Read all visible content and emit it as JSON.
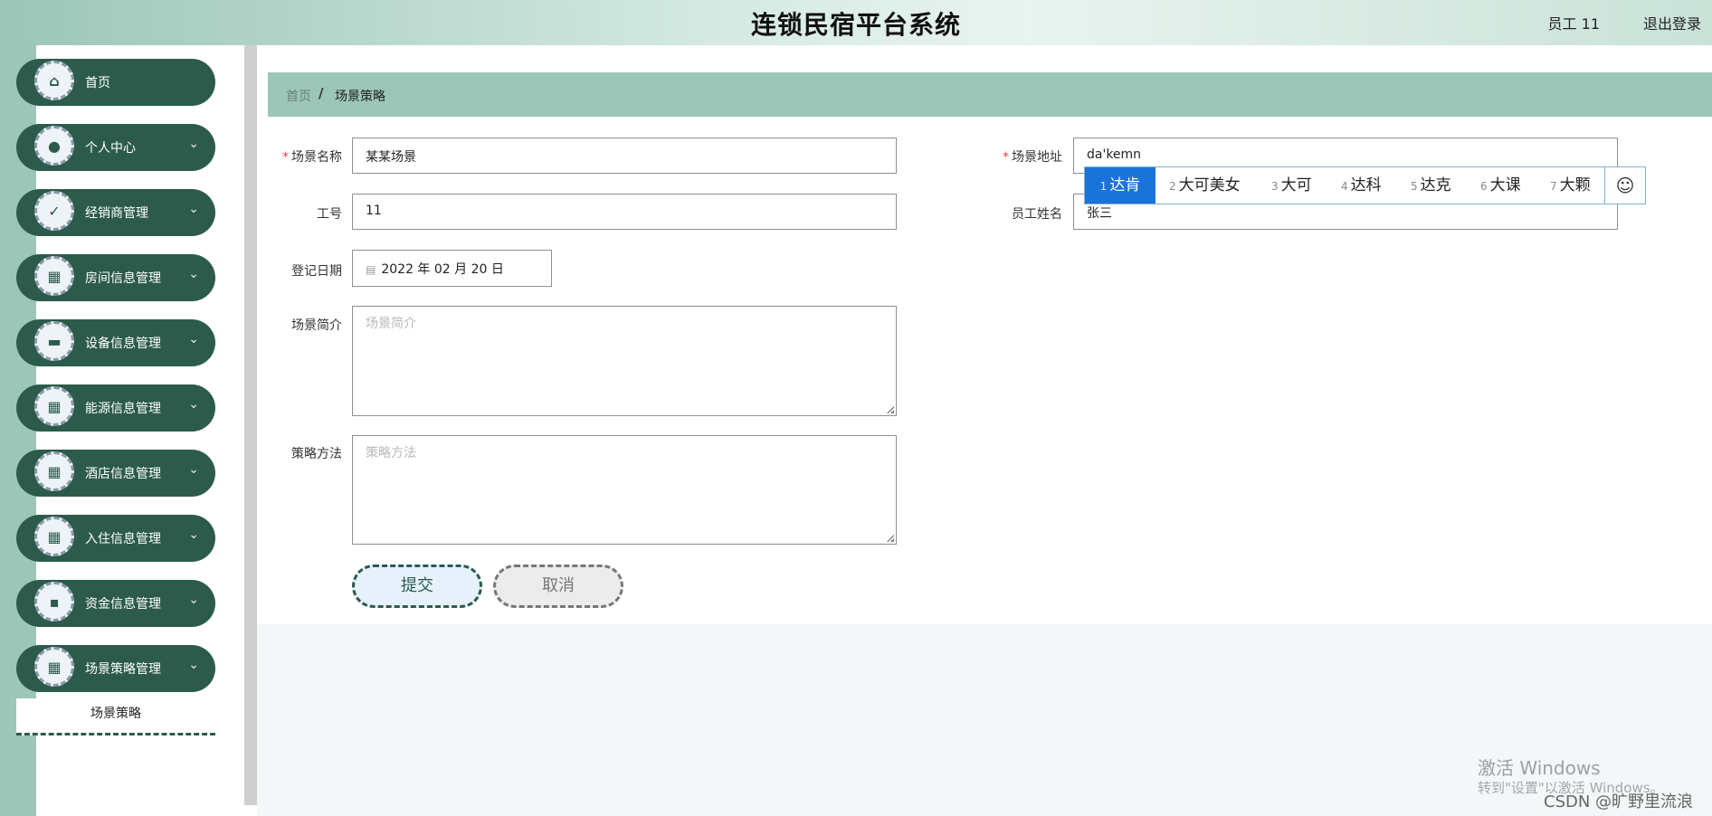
{
  "header": {
    "title": "连锁民宿平台系统",
    "user": "员工 11",
    "logout": "退出登录"
  },
  "sidebar": {
    "items": [
      {
        "label": "首页",
        "icon": "home-icon",
        "glyph": "⌂",
        "has_children": false
      },
      {
        "label": "个人中心",
        "icon": "user-icon",
        "glyph": "●",
        "has_children": true
      },
      {
        "label": "经销商管理",
        "icon": "clipboard-icon",
        "glyph": "✓",
        "has_children": true
      },
      {
        "label": "房间信息管理",
        "icon": "grid-icon",
        "glyph": "▦",
        "has_children": true
      },
      {
        "label": "设备信息管理",
        "icon": "device-icon",
        "glyph": "▬",
        "has_children": true
      },
      {
        "label": "能源信息管理",
        "icon": "grid-icon",
        "glyph": "▦",
        "has_children": true
      },
      {
        "label": "酒店信息管理",
        "icon": "grid-icon",
        "glyph": "▦",
        "has_children": true
      },
      {
        "label": "入住信息管理",
        "icon": "grid-icon",
        "glyph": "▦",
        "has_children": true
      },
      {
        "label": "资金信息管理",
        "icon": "chat-icon",
        "glyph": "▪",
        "has_children": true
      },
      {
        "label": "场景策略管理",
        "icon": "grid-icon",
        "glyph": "▦",
        "has_children": true
      }
    ],
    "submenu": {
      "label": "场景策略"
    },
    "chevron": "⌄"
  },
  "breadcrumb": {
    "home": "首页",
    "separator": "/",
    "current": "场景策略"
  },
  "form": {
    "scene_name": {
      "label": "场景名称",
      "value": "某某场景",
      "required": true
    },
    "scene_address": {
      "label": "场景地址",
      "value": "da'kemn",
      "required": true
    },
    "employee_no": {
      "label": "工号",
      "value": "11"
    },
    "employee_name": {
      "label": "员工姓名",
      "value": "张三"
    },
    "register_date": {
      "label": "登记日期",
      "value": "2022 年 02 月 20 日"
    },
    "scene_intro": {
      "label": "场景简介",
      "placeholder": "场景简介"
    },
    "strategy_method": {
      "label": "策略方法",
      "placeholder": "策略方法"
    },
    "required_mark": "*",
    "submit": "提交",
    "cancel": "取消"
  },
  "ime": {
    "candidates": [
      {
        "num": "1",
        "text": "达肯",
        "selected": true
      },
      {
        "num": "2",
        "text": "大可美女",
        "selected": false
      },
      {
        "num": "3",
        "text": "大可",
        "selected": false
      },
      {
        "num": "4",
        "text": "达科",
        "selected": false
      },
      {
        "num": "5",
        "text": "达克",
        "selected": false
      },
      {
        "num": "6",
        "text": "大课",
        "selected": false
      },
      {
        "num": "7",
        "text": "大颗",
        "selected": false
      }
    ],
    "emoji": "☺"
  },
  "watermark": {
    "line1": "激活 Windows",
    "line2": "转到\"设置\"以激活 Windows。",
    "csdn": "CSDN @旷野里流浪"
  },
  "colors": {
    "sidebar_item": "#2c5b4c",
    "accent": "#9cc6b7",
    "ime_selected": "#1a73d9"
  }
}
